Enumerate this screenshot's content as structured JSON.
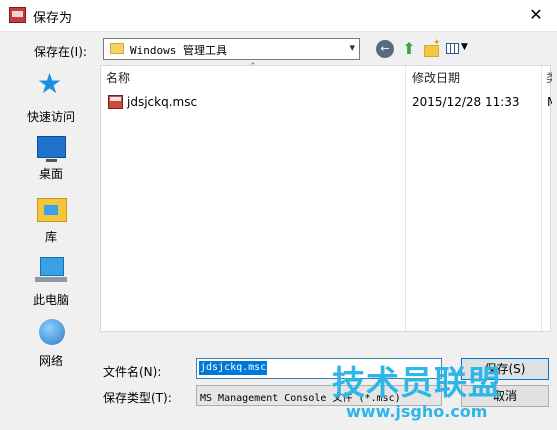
{
  "window": {
    "title": "保存为",
    "close_glyph": "✕"
  },
  "location": {
    "label": "保存在(I):",
    "path": "Windows 管理工具"
  },
  "toolbar": {
    "back": "back-icon",
    "up": "up-folder-icon",
    "new_folder": "new-folder-icon",
    "view": "view-menu-icon"
  },
  "places": [
    {
      "label": "快速访问",
      "icon": "star-icon"
    },
    {
      "label": "桌面",
      "icon": "desktop-icon"
    },
    {
      "label": "库",
      "icon": "library-icon"
    },
    {
      "label": "此电脑",
      "icon": "computer-icon"
    },
    {
      "label": "网络",
      "icon": "network-icon"
    }
  ],
  "list": {
    "headers": {
      "name": "名称",
      "date": "修改日期",
      "type": "类"
    },
    "files": [
      {
        "name": "jdsjckq.msc",
        "date": "2015/12/28 11:33",
        "type": "M"
      }
    ]
  },
  "form": {
    "filename_label": "文件名(N):",
    "filename_value": "jdsjckq.msc",
    "filetype_label": "保存类型(T):",
    "filetype_value": "MS Management Console 文件 (*.msc)",
    "save_label": "保存(S)",
    "cancel_label": "取消"
  },
  "watermark": {
    "main": "技术员联盟",
    "url": "www.jsgho.com"
  },
  "colors": {
    "accent": "#0078d7",
    "watermark": "#2fb6e8"
  }
}
